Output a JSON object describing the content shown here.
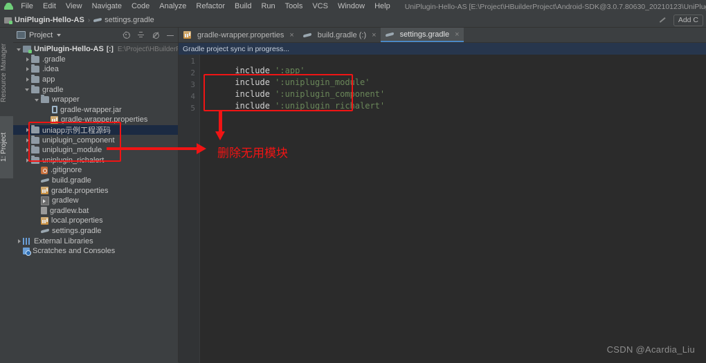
{
  "window": {
    "title": "UniPlugin-Hello-AS [E:\\Project\\HBuilderProject\\Android-SDK@3.0.7.80630_20210123\\UniPlugin-Hello-AS] - ...\\settings.gradle - Andro"
  },
  "menu": {
    "logo_icon": "android-logo-icon",
    "items": [
      {
        "label": "File"
      },
      {
        "label": "Edit"
      },
      {
        "label": "View"
      },
      {
        "label": "Navigate"
      },
      {
        "label": "Code"
      },
      {
        "label": "Analyze"
      },
      {
        "label": "Refactor"
      },
      {
        "label": "Build"
      },
      {
        "label": "Run"
      },
      {
        "label": "Tools"
      },
      {
        "label": "VCS"
      },
      {
        "label": "Window"
      },
      {
        "label": "Help"
      }
    ]
  },
  "navbar": {
    "project": "UniPlugin-Hello-AS",
    "separator": "›",
    "file": "settings.gradle",
    "collapse_icon": "chevron-up-icon",
    "add_config": "Add C"
  },
  "left_strip": {
    "resource_manager": "Resource Manager",
    "project": "1: Project"
  },
  "project_panel": {
    "title": "Project",
    "caret_icon": "chevron-down-icon",
    "icons": [
      {
        "name": "locate-target-icon"
      },
      {
        "name": "collapse-all-icon"
      },
      {
        "name": "settings-gear-icon"
      },
      {
        "name": "minimize-icon"
      }
    ],
    "tree": [
      {
        "indent": 0,
        "arrow": "open",
        "icon": "module",
        "label": "UniPlugin-Hello-AS",
        "bracket": "[:]",
        "path": "E:\\Project\\HBuilderProject\\",
        "bold": true
      },
      {
        "indent": 1,
        "arrow": "closed",
        "icon": "folder",
        "label": ".gradle"
      },
      {
        "indent": 1,
        "arrow": "closed",
        "icon": "folder",
        "label": ".idea"
      },
      {
        "indent": 1,
        "arrow": "closed",
        "icon": "folder",
        "label": "app"
      },
      {
        "indent": 1,
        "arrow": "open",
        "icon": "folder",
        "label": "gradle"
      },
      {
        "indent": 2,
        "arrow": "open",
        "icon": "folder",
        "label": "wrapper"
      },
      {
        "indent": 3,
        "arrow": "none",
        "icon": "jar",
        "label": "gradle-wrapper.jar"
      },
      {
        "indent": 3,
        "arrow": "none",
        "icon": "props",
        "label": "gradle-wrapper.properties"
      },
      {
        "indent": 1,
        "arrow": "closed",
        "icon": "folder",
        "label": "uniapp示例工程源码",
        "selected": true
      },
      {
        "indent": 1,
        "arrow": "closed",
        "icon": "folder",
        "label": "uniplugin_component"
      },
      {
        "indent": 1,
        "arrow": "closed",
        "icon": "folder",
        "label": "uniplugin_module"
      },
      {
        "indent": 1,
        "arrow": "closed",
        "icon": "folder",
        "label": "uniplugin_richalert"
      },
      {
        "indent": 2,
        "arrow": "none",
        "icon": "git",
        "label": ".gitignore"
      },
      {
        "indent": 2,
        "arrow": "none",
        "icon": "gradlef",
        "label": "build.gradle"
      },
      {
        "indent": 2,
        "arrow": "none",
        "icon": "props",
        "label": "gradle.properties"
      },
      {
        "indent": 2,
        "arrow": "none",
        "icon": "sh",
        "label": "gradlew"
      },
      {
        "indent": 2,
        "arrow": "none",
        "icon": "bat",
        "label": "gradlew.bat"
      },
      {
        "indent": 2,
        "arrow": "none",
        "icon": "props",
        "label": "local.properties"
      },
      {
        "indent": 2,
        "arrow": "none",
        "icon": "gradlef",
        "label": "settings.gradle"
      },
      {
        "indent": 0,
        "arrow": "closed",
        "icon": "lib",
        "label": "External Libraries"
      },
      {
        "indent": 0,
        "arrow": "none",
        "icon": "scr",
        "label": "Scratches and Consoles"
      }
    ]
  },
  "editor": {
    "tabs": [
      {
        "label": "gradle-wrapper.properties",
        "icon": "properties-file-icon",
        "active": false,
        "close": "×"
      },
      {
        "label": "build.gradle (:)",
        "icon": "gradle-file-icon",
        "active": false,
        "close": "×"
      },
      {
        "label": "settings.gradle",
        "icon": "gradle-file-icon",
        "active": true,
        "close": "×"
      }
    ],
    "sync_banner": "Gradle project sync in progress...",
    "line_numbers": [
      "1",
      "2",
      "3",
      "4",
      "5"
    ],
    "lines": [
      {
        "keyword": "include",
        "string": "':app'"
      },
      {
        "keyword": "include",
        "string": "':uniplugin_module'"
      },
      {
        "keyword": "include",
        "string": "':uniplugin_component'"
      },
      {
        "keyword": "include",
        "string": "':uniplugin_richalert'"
      },
      {
        "keyword": "",
        "string": ""
      }
    ]
  },
  "annotations": {
    "color": "#f01414",
    "note_text": "删除无用模块",
    "vertical_arrow": "down-arrow-annotation",
    "horizontal_arrow": "right-arrow-annotation",
    "code_box": "code-highlight-box",
    "tree_box": "tree-highlight-box"
  },
  "watermark": {
    "text": "CSDN @Acardia_Liu"
  }
}
